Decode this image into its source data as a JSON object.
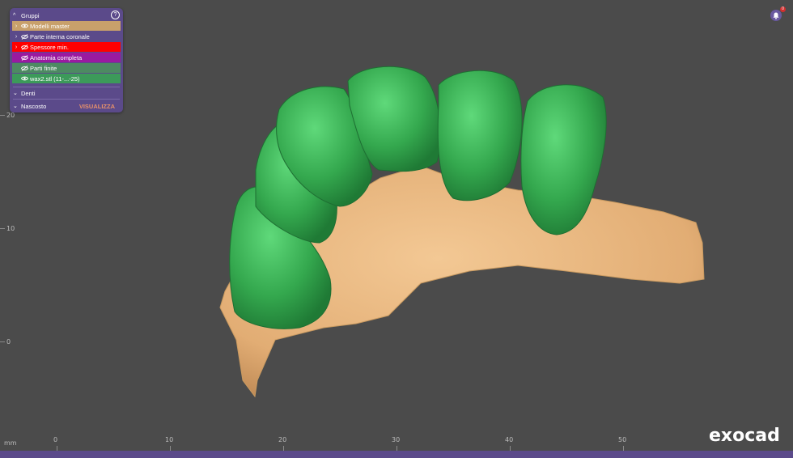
{
  "panel": {
    "title": "Gruppi",
    "help": "?",
    "rows": [
      {
        "label": "Modelli master",
        "color": "#c8a06b",
        "text_color": "#ffffff"
      },
      {
        "label": "Parte interna coronale",
        "color": "#5b4a8a",
        "text_color": "#ffffff"
      },
      {
        "label": "Spessore min.",
        "color": "#ff0000",
        "text_color": "#ffffff"
      },
      {
        "label": "Anatomia completa",
        "color": "#9a1aa0",
        "text_color": "#ffffff"
      },
      {
        "label": "Parti finite",
        "color": "#4d8a62",
        "text_color": "#ffffff"
      },
      {
        "label": "wax2.stl (11-...-25)",
        "color": "#3c9a5a",
        "text_color": "#ffffff"
      }
    ],
    "denti": "Denti",
    "nascosto": "Nascosto",
    "visualizza": "VISUALIZZA"
  },
  "notifications": {
    "count": "0"
  },
  "ruler": {
    "unit": "mm",
    "y_ticks": [
      "20",
      "10",
      "0"
    ],
    "x_ticks": [
      "0",
      "10",
      "20",
      "30",
      "40",
      "50"
    ]
  },
  "logo": "exocad",
  "colors": {
    "tooth": "#2fa34c",
    "model": "#e6b47e",
    "background": "#4b4b4b",
    "accent": "#5b4a8a"
  }
}
